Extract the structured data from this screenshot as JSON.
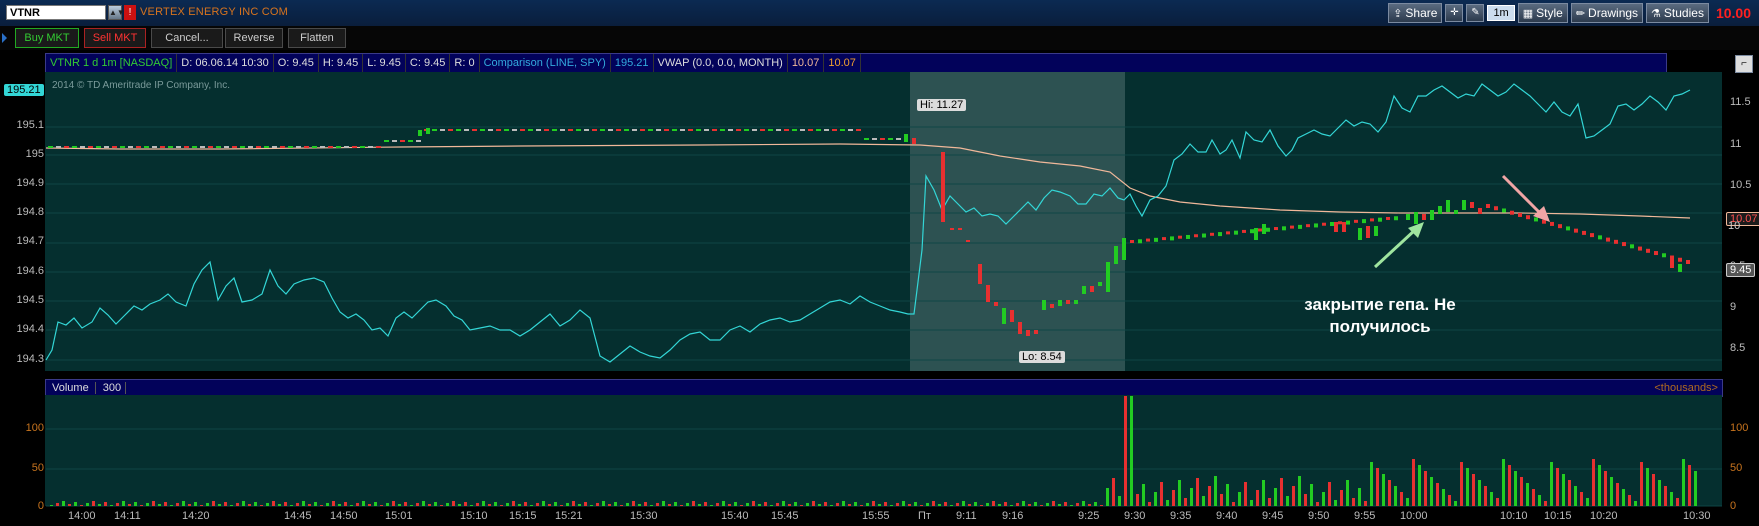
{
  "titlebar": {
    "symbol": "VTNR",
    "company": "VERTEX ENERGY INC COM",
    "share_label": "Share",
    "timeframe": "1m",
    "style_label": "Style",
    "drawings_label": "Drawings",
    "studies_label": "Studies",
    "last_price": "10.00"
  },
  "orderbar": {
    "buttons": [
      "Buy MKT",
      "Sell MKT",
      "Cancel...",
      "Reverse",
      "Flatten"
    ]
  },
  "studybar": {
    "symbol": "VTNR 1 d 1m [NASDAQ]",
    "date": "D: 06.06.14 10:30",
    "open": "O: 9.45",
    "high": "H: 9.45",
    "low": "L: 9.45",
    "close": "C: 9.45",
    "range": "R: 0",
    "comparison": "Comparison (LINE, SPY)",
    "comparison_value": "195.21",
    "vwap": "VWAP (0.0, 0.0, MONTH)",
    "vwap_v1": "10.07",
    "vwap_v2": "10.07"
  },
  "copyright": "2014 © TD Ameritrade IP Company, Inc.",
  "left_axis": {
    "labels": [
      "195.1",
      "195",
      "194.9",
      "194.8",
      "194.7",
      "194.6",
      "194.5",
      "194.4",
      "194.3"
    ],
    "current": "195.21"
  },
  "right_axis": {
    "labels": [
      "11.5",
      "11",
      "10.5",
      "10",
      "9.5",
      "9",
      "8.5"
    ],
    "vwap_tag": "10.07",
    "price_tag": "9.45"
  },
  "markers": {
    "high": "Hi: 11.27",
    "low": "Lo: 8.54"
  },
  "annotation": {
    "line1": "закрытие гепа. Не",
    "line2": "получилось"
  },
  "volume": {
    "title": "Volume",
    "value": "300",
    "units": "<thousands>",
    "y_labels_left": [
      "100",
      "50",
      "0"
    ],
    "y_labels_right": [
      "100",
      "50",
      "0"
    ]
  },
  "x_axis": {
    "labels": [
      "14:00",
      "14:11",
      "14:20",
      "14:45",
      "14:50",
      "15:01",
      "15:10",
      "15:15",
      "15:21",
      "15:30",
      "15:40",
      "15:45",
      "15:55",
      "Пт",
      "9:11",
      "9:16",
      "9:25",
      "9:30",
      "9:35",
      "9:40",
      "9:45",
      "9:50",
      "9:55",
      "10:00",
      "10:10",
      "10:15",
      "10:20",
      "10:30"
    ]
  },
  "colors": {
    "pane_bg": "#052f2f",
    "up_candle": "#22cc22",
    "down_candle": "#e83030",
    "spy_line": "#33d6d6",
    "vwap_line": "#f0b89a",
    "highlight": "#4f6f6f"
  }
}
